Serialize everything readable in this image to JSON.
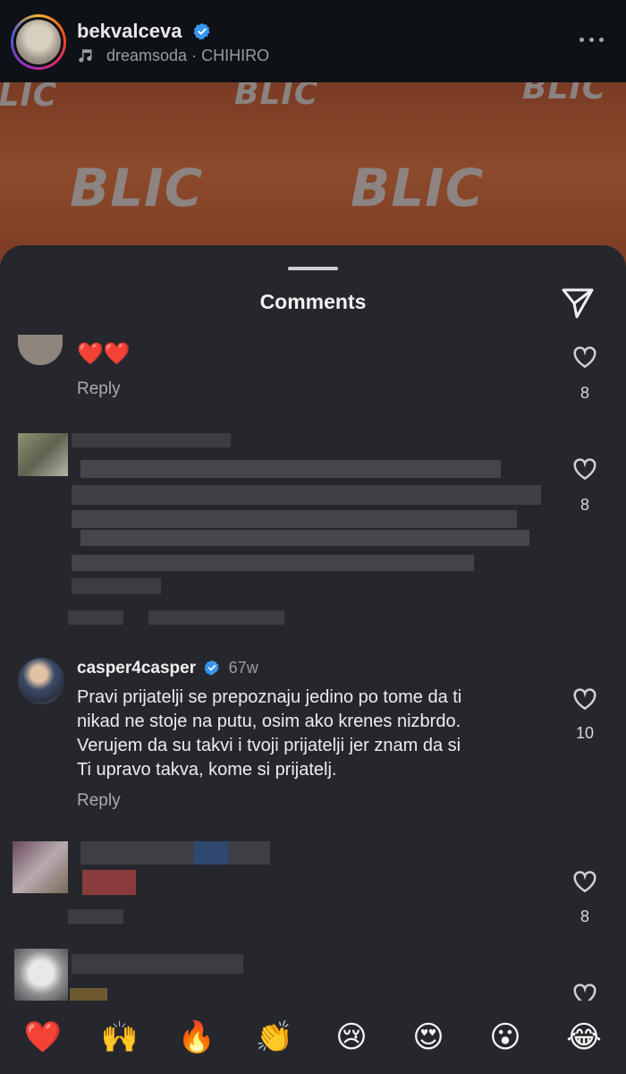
{
  "post": {
    "username": "bekvalceva",
    "audio": "dreamsoda · CHIHIRO",
    "watermark": "BLIC"
  },
  "sheet": {
    "title": "Comments"
  },
  "comments": [
    {
      "text": "❤️❤️",
      "reply_label": "Reply",
      "likes": "8"
    },
    {
      "likes": "8"
    },
    {
      "username": "casper4casper",
      "time": "67w",
      "text": "Pravi prijatelji se prepoznaju jedino po tome da ti\nnikad ne stoje na putu, osim ako krenes nizbrdo.\nVerujem da su takvi i tvoji prijatelji jer znam da si\nTi upravo takva, kome si prijatelj.",
      "reply_label": "Reply",
      "likes": "10"
    },
    {
      "likes": "8"
    },
    {
      "likes": ""
    }
  ],
  "emoji_bar": [
    "❤️",
    "🙌",
    "🔥",
    "👏",
    "😢",
    "😍",
    "😮",
    "😂"
  ],
  "icons": {
    "verified": "verified-badge-icon",
    "audio": "music-note-icon",
    "more": "more-dots-icon",
    "send": "send-icon",
    "like": "heart-outline-icon"
  },
  "colors": {
    "sheet_bg": "#25272d",
    "verified_blue": "#3797f0",
    "media_bg": "#8c4a2c"
  }
}
